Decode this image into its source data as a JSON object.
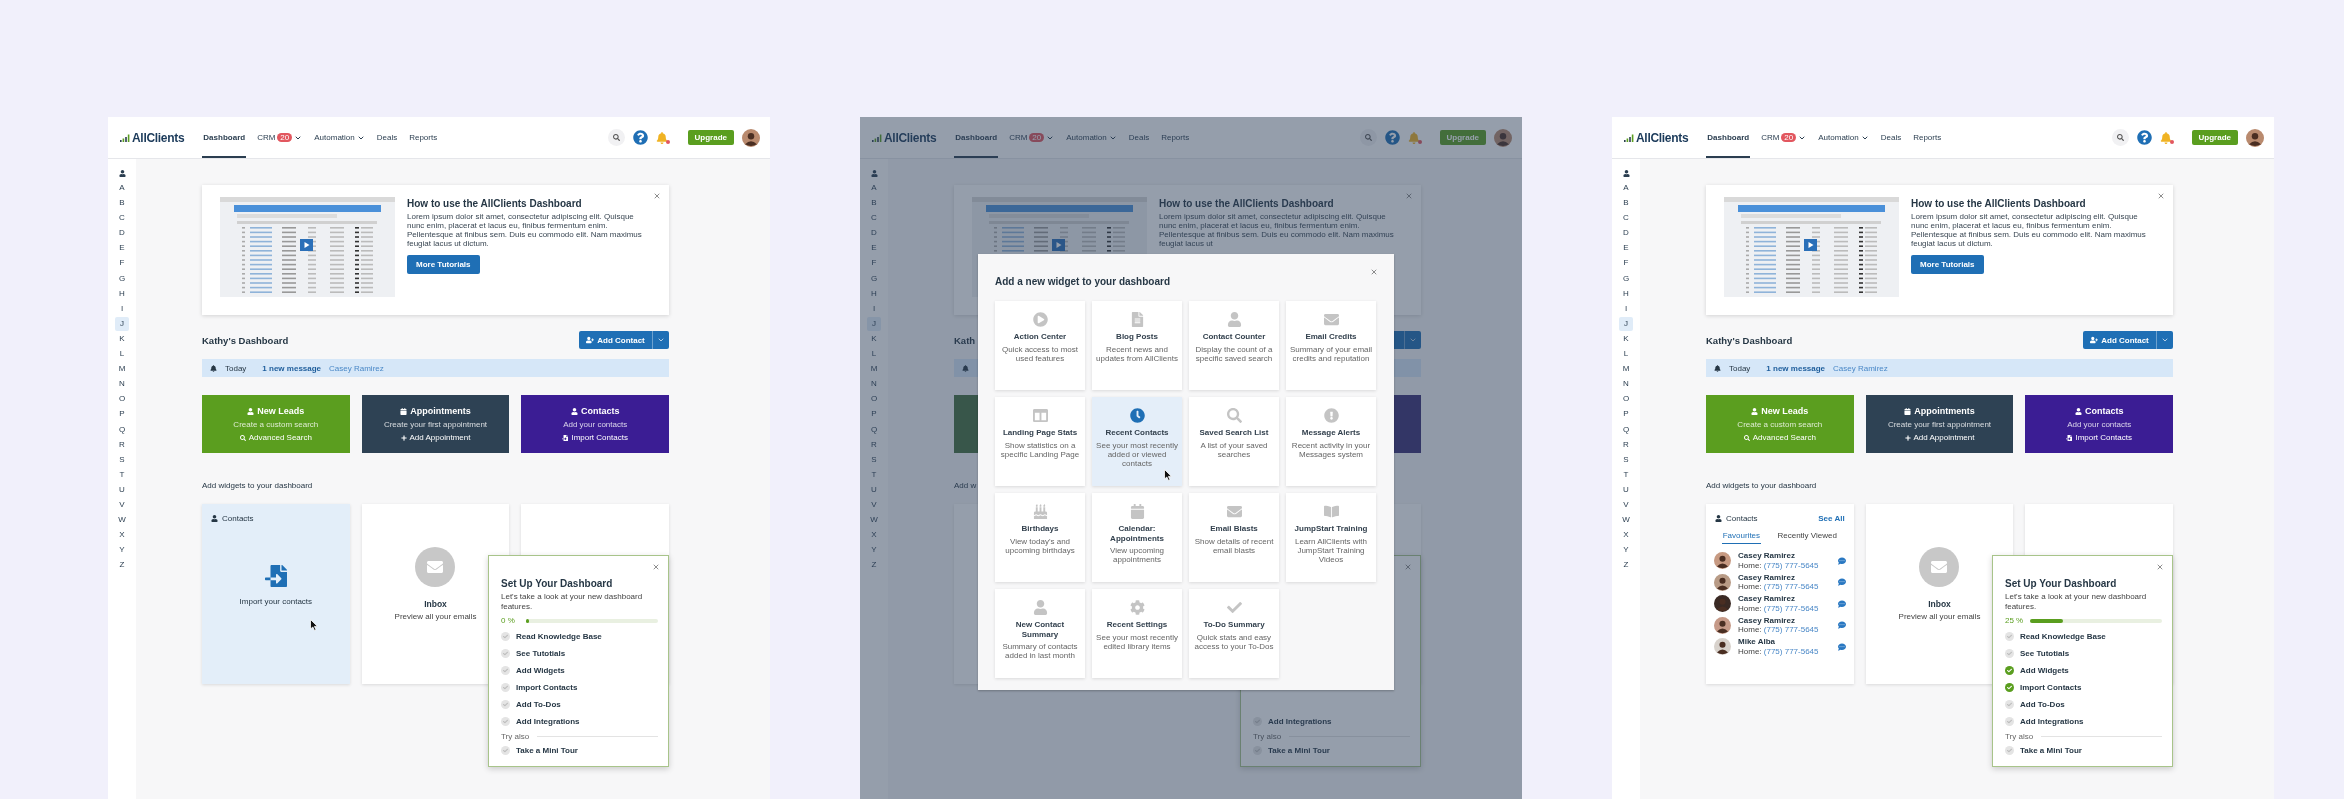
{
  "panels": [
    {
      "kind": "dashboard",
      "nav": {
        "logo": "AllClients",
        "items": [
          {
            "label": "Dashboard",
            "selected": true
          },
          {
            "label": "CRM",
            "badge": "20",
            "dropdown": true,
            "selected": false
          },
          {
            "label": "Automation",
            "dropdown": true,
            "selected": false
          },
          {
            "label": "Deals",
            "selected": false
          },
          {
            "label": "Reports",
            "selected": false
          }
        ],
        "upgrade": "Upgrade"
      },
      "sidebar": {
        "letters": [
          {
            "label": "A",
            "selected": false
          },
          {
            "label": "B",
            "selected": false
          },
          {
            "label": "C",
            "selected": false
          },
          {
            "label": "D",
            "selected": false
          },
          {
            "label": "E",
            "selected": false
          },
          {
            "label": "F",
            "selected": false
          },
          {
            "label": "G",
            "selected": false
          },
          {
            "label": "H",
            "selected": false
          },
          {
            "label": "I",
            "selected": false
          },
          {
            "label": "J",
            "selected": true
          },
          {
            "label": "K",
            "selected": false
          },
          {
            "label": "L",
            "selected": false
          },
          {
            "label": "M",
            "selected": false
          },
          {
            "label": "N",
            "selected": false
          },
          {
            "label": "O",
            "selected": false
          },
          {
            "label": "P",
            "selected": false
          },
          {
            "label": "Q",
            "selected": false
          },
          {
            "label": "R",
            "selected": false
          },
          {
            "label": "S",
            "selected": false
          },
          {
            "label": "T",
            "selected": false
          },
          {
            "label": "U",
            "selected": false
          },
          {
            "label": "V",
            "selected": false
          },
          {
            "label": "W",
            "selected": false
          },
          {
            "label": "X",
            "selected": false
          },
          {
            "label": "Y",
            "selected": false
          },
          {
            "label": "Z",
            "selected": false
          }
        ]
      },
      "tutorial": {
        "title": "How to use the AllClients Dashboard",
        "body": "Lorem ipsum dolor sit amet, consectetur adipiscing elit. Quisque nunc enim, placerat et lacus eu, finibus fermentum enim. Pellentesque at finibus sem. Duis eu commodo elit. Nam maximus feugiat lacus ut dictum.",
        "button": "More Tutorials"
      },
      "heading": "Kathy's Dashboard",
      "add_contact": "Add Contact",
      "today": {
        "label": "Today",
        "message": "1 new message",
        "sender": "Casey Ramirez"
      },
      "stat_cards": [
        {
          "title": "New Leads",
          "subtitle": "Create a custom search",
          "action": "Advanced Search",
          "color": "#5b9e1f"
        },
        {
          "title": "Appointments",
          "subtitle": "Create your first appointment",
          "action": "Add Appointment",
          "color": "#2e4254"
        },
        {
          "title": "Contacts",
          "subtitle": "Add your contacts",
          "action": "Import Contacts",
          "color": "#3b1d94"
        }
      ],
      "widgets_heading": "Add widgets to your dashboard",
      "widgets": [
        {
          "kind": "import",
          "title": "Contacts",
          "caption": "Import your contacts",
          "highlighted": true
        },
        {
          "kind": "inbox",
          "title": "Inbox",
          "subtitle": "Preview all your emails"
        },
        {
          "kind": "blank"
        }
      ],
      "setup": {
        "title": "Set Up Your Dashboard",
        "subtitle": "Let's take a look at your new dashboard features.",
        "progress": {
          "reading": "0 %",
          "level": 0
        },
        "items": [
          {
            "label": "Read Knowledge Base",
            "checked": false
          },
          {
            "label": "See Tutotials",
            "checked": false
          },
          {
            "label": "Add Widgets",
            "checked": false
          },
          {
            "label": "Import Contacts",
            "checked": false
          },
          {
            "label": "Add To-Dos",
            "checked": false
          },
          {
            "label": "Add Integrations",
            "checked": false
          }
        ],
        "extra_label": "Try also",
        "extra_items": [
          {
            "label": "Take a Mini Tour",
            "checked": false
          }
        ]
      }
    },
    {
      "kind": "dashboard_with_modal",
      "nav": {
        "logo": "AllClients",
        "items": [
          {
            "label": "Dashboard",
            "selected": true
          },
          {
            "label": "CRM",
            "badge": "20",
            "dropdown": true,
            "selected": false
          },
          {
            "label": "Automation",
            "dropdown": true,
            "selected": false
          },
          {
            "label": "Deals",
            "selected": false
          },
          {
            "label": "Reports",
            "selected": false
          }
        ],
        "upgrade": "Upgrade"
      },
      "sidebar": {
        "letters": [
          {
            "label": "A",
            "selected": false
          },
          {
            "label": "B",
            "selected": false
          },
          {
            "label": "C",
            "selected": false
          },
          {
            "label": "D",
            "selected": false
          },
          {
            "label": "E",
            "selected": false
          },
          {
            "label": "F",
            "selected": false
          },
          {
            "label": "G",
            "selected": false
          },
          {
            "label": "H",
            "selected": false
          },
          {
            "label": "I",
            "selected": false
          },
          {
            "label": "J",
            "selected": true
          },
          {
            "label": "K",
            "selected": false
          },
          {
            "label": "L",
            "selected": false
          },
          {
            "label": "M",
            "selected": false
          },
          {
            "label": "N",
            "selected": false
          },
          {
            "label": "O",
            "selected": false
          },
          {
            "label": "P",
            "selected": false
          },
          {
            "label": "Q",
            "selected": false
          },
          {
            "label": "R",
            "selected": false
          },
          {
            "label": "S",
            "selected": false
          },
          {
            "label": "T",
            "selected": false
          },
          {
            "label": "U",
            "selected": false
          },
          {
            "label": "V",
            "selected": false
          },
          {
            "label": "W",
            "selected": false
          },
          {
            "label": "X",
            "selected": false
          },
          {
            "label": "Y",
            "selected": false
          },
          {
            "label": "Z",
            "selected": false
          }
        ]
      },
      "tutorial": {
        "title": "How to use the AllClients Dashboard",
        "body": "Lorem ipsum dolor sit amet, consectetur adipiscing elit. Quisque nunc enim, placerat et lacus eu, finibus fermentum enim. Pellentesque at finibus sem. Duis eu commodo elit. Nam maximus feugiat lacus ut"
      },
      "heading": "Kath",
      "widgets_heading": "Add w",
      "widgets": [
        {
          "kind": "blank"
        },
        {
          "kind": "covered"
        },
        {
          "kind": "blank"
        }
      ],
      "setup": {
        "items": [
          {
            "label": "Add Integrations",
            "checked": false
          }
        ],
        "extra_label": "Try also",
        "extra_items": [
          {
            "label": "Take a Mini Tour",
            "checked": false
          }
        ]
      },
      "modal": {
        "title": "Add a new widget to your dashboard",
        "tiles": [
          {
            "title": "Action Center",
            "description": "Quick access to most used features",
            "selected": false
          },
          {
            "title": "Blog Posts",
            "description": "Recent news and updates from AllClients",
            "selected": false
          },
          {
            "title": "Contact Counter",
            "description": "Display the count of a specific saved search",
            "selected": false
          },
          {
            "title": "Email Credits",
            "description": "Summary of your email credits and reputation",
            "selected": false
          },
          {
            "title": "Landing Page Stats",
            "description": "Show statistics on a specific Landing Page",
            "selected": false
          },
          {
            "title": "Recent Contacts",
            "description": "See your most recently added or viewed contacts",
            "selected": true
          },
          {
            "title": "Saved Search List",
            "description": "A list of your saved searches",
            "selected": false
          },
          {
            "title": "Message Alerts",
            "description": "Recent activity in your Messages system",
            "selected": false
          },
          {
            "title": "Birthdays",
            "description": "View today's and upcoming birthdays",
            "selected": false
          },
          {
            "title": "Calendar: Appointments",
            "description": "View upcoming appointments",
            "selected": false
          },
          {
            "title": "Email Blasts",
            "description": "Show details of recent email blasts",
            "selected": false
          },
          {
            "title": "JumpStart Training",
            "description": "Learn AllClients with JumpStart Training Videos",
            "selected": false
          },
          {
            "title": "New Contact Summary",
            "description": "Summary of contacts added in last month",
            "selected": false
          },
          {
            "title": "Recent Settings",
            "description": "See your most recently edited library items",
            "selected": false
          },
          {
            "title": "To-Do Summary",
            "description": "Quick stats and easy access to your To-Dos",
            "selected": false
          }
        ]
      }
    },
    {
      "kind": "dashboard",
      "nav": {
        "logo": "AllClients",
        "items": [
          {
            "label": "Dashboard",
            "selected": true
          },
          {
            "label": "CRM",
            "badge": "20",
            "dropdown": true,
            "selected": false
          },
          {
            "label": "Automation",
            "dropdown": true,
            "selected": false
          },
          {
            "label": "Deals",
            "selected": false
          },
          {
            "label": "Reports",
            "selected": false
          }
        ],
        "upgrade": "Upgrade"
      },
      "sidebar": {
        "letters": [
          {
            "label": "A",
            "selected": false
          },
          {
            "label": "B",
            "selected": false
          },
          {
            "label": "C",
            "selected": false
          },
          {
            "label": "D",
            "selected": false
          },
          {
            "label": "E",
            "selected": false
          },
          {
            "label": "F",
            "selected": false
          },
          {
            "label": "G",
            "selected": false
          },
          {
            "label": "H",
            "selected": false
          },
          {
            "label": "I",
            "selected": false
          },
          {
            "label": "J",
            "selected": true
          },
          {
            "label": "K",
            "selected": false
          },
          {
            "label": "L",
            "selected": false
          },
          {
            "label": "M",
            "selected": false
          },
          {
            "label": "N",
            "selected": false
          },
          {
            "label": "O",
            "selected": false
          },
          {
            "label": "P",
            "selected": false
          },
          {
            "label": "Q",
            "selected": false
          },
          {
            "label": "R",
            "selected": false
          },
          {
            "label": "S",
            "selected": false
          },
          {
            "label": "T",
            "selected": false
          },
          {
            "label": "U",
            "selected": false
          },
          {
            "label": "V",
            "selected": false
          },
          {
            "label": "W",
            "selected": false
          },
          {
            "label": "X",
            "selected": false
          },
          {
            "label": "Y",
            "selected": false
          },
          {
            "label": "Z",
            "selected": false
          }
        ]
      },
      "tutorial": {
        "title": "How to use the AllClients Dashboard",
        "body": "Lorem ipsum dolor sit amet, consectetur adipiscing elit. Quisque nunc enim, placerat et lacus eu, finibus fermentum enim. Pellentesque at finibus sem. Duis eu commodo elit. Nam maximus feugiat lacus ut dictum.",
        "button": "More Tutorials"
      },
      "heading": "Kathy's Dashboard",
      "add_contact": "Add Contact",
      "today": {
        "label": "Today",
        "message": "1 new message",
        "sender": "Casey Ramirez"
      },
      "stat_cards": [
        {
          "title": "New Leads",
          "subtitle": "Create a custom search",
          "action": "Advanced Search",
          "color": "#5b9e1f"
        },
        {
          "title": "Appointments",
          "subtitle": "Create your first appointment",
          "action": "Add Appointment",
          "color": "#2e4254"
        },
        {
          "title": "Contacts",
          "subtitle": "Add your contacts",
          "action": "Import Contacts",
          "color": "#3b1d94"
        }
      ],
      "widgets_heading": "Add widgets to your dashboard",
      "widgets": [
        {
          "kind": "contacts",
          "title": "Contacts",
          "link": "See All",
          "tabs": [
            {
              "label": "Favourites",
              "selected": true
            },
            {
              "label": "Recently Viewed",
              "selected": false
            }
          ],
          "contacts": [
            {
              "name": "Casey Ramirez",
              "label": "Home:",
              "phone": "(775) 777-5645"
            },
            {
              "name": "Casey Ramirez",
              "label": "Home:",
              "phone": "(775) 777-5645"
            },
            {
              "name": "Casey Ramirez",
              "label": "Home:",
              "phone": "(775) 777-5645"
            },
            {
              "name": "Casey Ramirez",
              "label": "Home:",
              "phone": "(775) 777-5645"
            },
            {
              "name": "Mike Alba",
              "label": "Home:",
              "phone": "(775) 777-5645"
            }
          ]
        },
        {
          "kind": "inbox",
          "title": "Inbox",
          "subtitle": "Preview all your emails"
        },
        {
          "kind": "blank"
        }
      ],
      "setup": {
        "title": "Set Up Your Dashboard",
        "subtitle": "Let's take a look at your new dashboard features.",
        "progress": {
          "reading": "25 %",
          "level": 0.25
        },
        "items": [
          {
            "label": "Read Knowledge Base",
            "checked": false
          },
          {
            "label": "See Tutotials",
            "checked": false
          },
          {
            "label": "Add Widgets",
            "checked": true
          },
          {
            "label": "Import Contacts",
            "checked": true
          },
          {
            "label": "Add To-Dos",
            "checked": false
          },
          {
            "label": "Add Integrations",
            "checked": false
          }
        ],
        "extra_label": "Try also",
        "extra_items": [
          {
            "label": "Take a Mini Tour",
            "checked": false
          }
        ]
      }
    }
  ]
}
